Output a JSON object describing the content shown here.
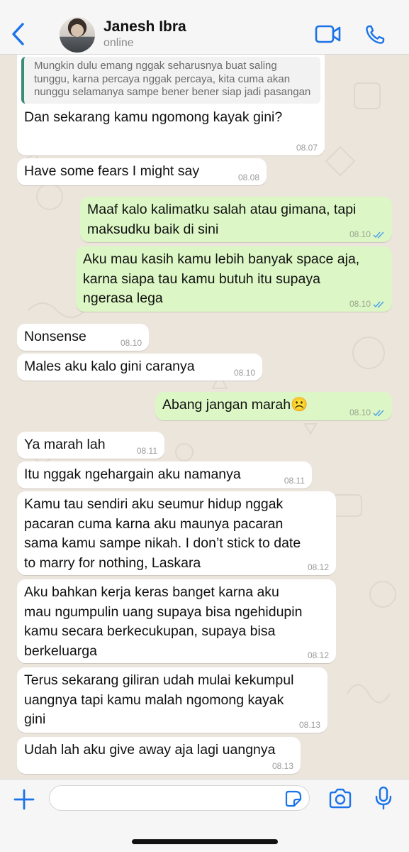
{
  "header": {
    "contact_name": "Janesh Ibra",
    "status": "online"
  },
  "messages": [
    {
      "side": "in",
      "quote": "Mungkin dulu emang nggak seharusnya buat saling tunggu, karna percaya nggak percaya, kita cuma akan nunggu selamanya sampe bener bener siap jadi pasangan",
      "text": "Dan sekarang kamu ngomong kayak gini?",
      "time": "08.07"
    },
    {
      "side": "in",
      "text": "Have some fears I might say",
      "time": "08.08"
    },
    {
      "side": "out",
      "text": "Maaf kalo kalimatku salah atau gimana, tapi\nmaksudku baik di sini",
      "time": "08.10"
    },
    {
      "side": "out",
      "text": "Aku mau kasih kamu lebih banyak space aja,\nkarna siapa tau kamu butuh itu supaya\nngerasa lega",
      "time": "08.10"
    },
    {
      "side": "in",
      "text": "Nonsense",
      "time": "08.10"
    },
    {
      "side": "in",
      "text": "Males aku kalo gini caranya",
      "time": "08.10"
    },
    {
      "side": "out",
      "text": "Abang jangan marah☹️",
      "time": "08.10"
    },
    {
      "side": "in",
      "text": "Ya marah lah",
      "time": "08.11"
    },
    {
      "side": "in",
      "text": "Itu nggak ngehargain aku namanya",
      "time": "08.11"
    },
    {
      "side": "in",
      "text": "Kamu tau sendiri aku seumur hidup nggak\npacaran cuma karna aku maunya pacaran\nsama kamu sampe nikah. I don’t stick to date\nto marry for nothing, Laskara",
      "time": "08.12"
    },
    {
      "side": "in",
      "text": "Aku bahkan kerja keras banget karna aku\nmau ngumpulin uang supaya bisa ngehidupin\nkamu secara berkecukupan, supaya bisa\nberkeluarga",
      "time": "08.12"
    },
    {
      "side": "in",
      "text": "Terus sekarang giliran udah mulai kekumpul\nuangnya tapi kamu malah ngomong kayak\ngini",
      "time": "08.13"
    },
    {
      "side": "in",
      "text": "Udah lah aku give away aja lagi uangnya",
      "time": "08.13"
    }
  ],
  "composer": {
    "value": "",
    "placeholder": ""
  },
  "colors": {
    "accent": "#1a73e8",
    "outgoing_bubble": "#dcf7c5",
    "incoming_bubble": "#ffffff",
    "chat_background": "#ece5dc"
  },
  "icons": [
    "back-arrow-icon",
    "video-call-icon",
    "phone-icon",
    "plus-icon",
    "sticker-icon",
    "camera-icon",
    "microphone-icon",
    "double-check-icon"
  ]
}
